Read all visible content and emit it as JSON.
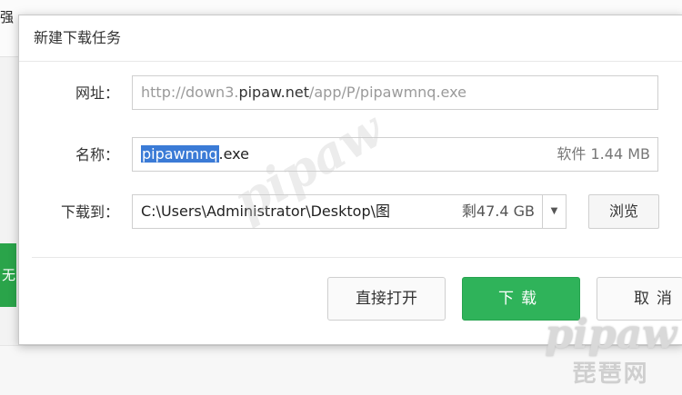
{
  "background": {
    "top_fragment": "强",
    "left_button_fragment": "无"
  },
  "dialog": {
    "title": "新建下载任务",
    "url": {
      "label": "网址：",
      "prefix": "http://down3.",
      "domain": "pipaw.net",
      "suffix": "/app/P/pipawmnq.exe"
    },
    "name": {
      "label": "名称：",
      "selected": "pipawmnq",
      "extension": ".exe",
      "meta": "软件 1.44 MB"
    },
    "save_to": {
      "label": "下载到：",
      "path": "C:\\Users\\Administrator\\Desktop\\图",
      "free_space": "剩47.4 GB",
      "dropdown_icon": "▼",
      "browse_label": "浏览"
    },
    "buttons": {
      "open": "直接打开",
      "download": "下载",
      "cancel": "取消"
    }
  },
  "watermark": {
    "logo": "pipaw",
    "sub": "琵琶网"
  },
  "colors": {
    "download_button": "#2fb35a",
    "selection": "#3b7bd6"
  }
}
